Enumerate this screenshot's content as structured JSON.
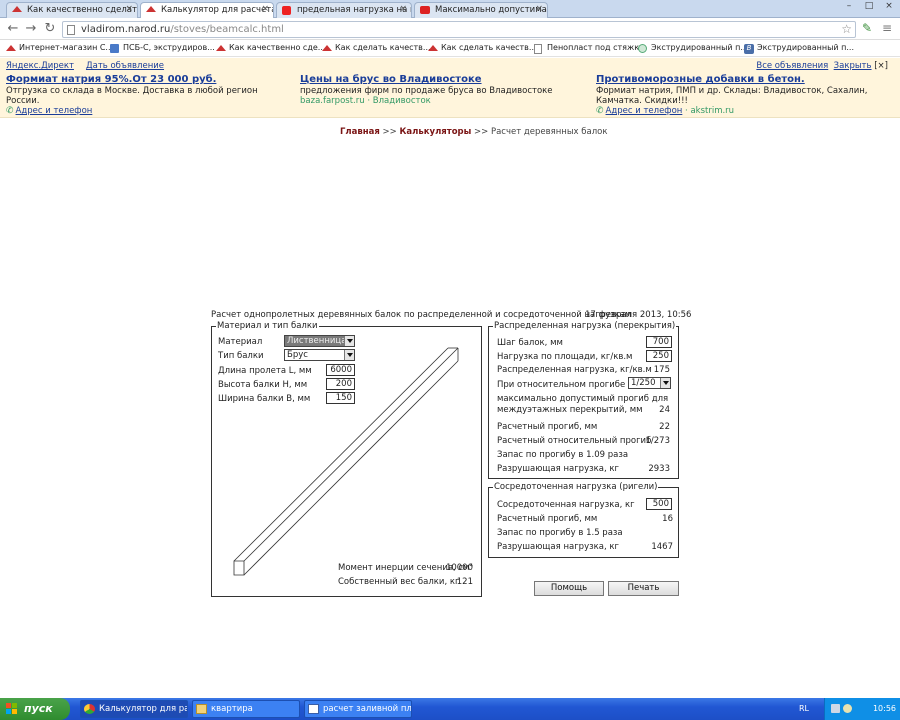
{
  "browser": {
    "tabs": [
      {
        "label": "Как качественно сделать"
      },
      {
        "label": "Калькулятор для расчета д"
      },
      {
        "label": "предельная нагрузка на п"
      },
      {
        "label": "Максимально допустимая"
      }
    ],
    "url_host": "vladirom.narod.ru",
    "url_path": "/stoves/beamcalc.html",
    "bookmarks": [
      {
        "label": "Интернет-магазин С..."
      },
      {
        "label": "ПСБ-С, экструдиров..."
      },
      {
        "label": "Как качественно сде..."
      },
      {
        "label": "Как сделать качеств..."
      },
      {
        "label": "Как сделать качеств..."
      },
      {
        "label": "Пенопласт под стяжку"
      },
      {
        "label": "Экструдированный п..."
      },
      {
        "label": "Экструдированный п..."
      }
    ]
  },
  "direct": {
    "brand": "Яндекс.Директ",
    "give_ad": "Дать объявление",
    "all_ads": "Все объявления",
    "close": "Закрыть",
    "close_box": "[×]",
    "ads": [
      {
        "title": "Формиат натрия 95%.От 23 000 руб.",
        "desc": "Отгрузка со склада в Москве. Доставка в любой регион России.",
        "contact": "Адрес и телефон",
        "site": "",
        "region": ""
      },
      {
        "title": "Цены на брус во Владивостоке",
        "desc": "предложения фирм по продаже бруса во Владивостоке",
        "contact": "",
        "site": "baza.farpost.ru",
        "region": "Владивосток"
      },
      {
        "title": "Противоморозные добавки в бетон.",
        "desc": "Формиат натрия, ПМП и др. Склады: Владивосток, Сахалин, Камчатка. Скидки!!!",
        "contact": "Адрес и телефон",
        "site": "akstrim.ru",
        "region": ""
      }
    ]
  },
  "breadcrumb": {
    "home": "Главная",
    "sep1": " >> ",
    "calcs": "Калькуляторы",
    "sep2": " >> ",
    "current": "Расчет деревянных балок"
  },
  "calc": {
    "heading": "Расчет однопролетных деревянных балок по распределенной и сосредоточенной нагрузкам",
    "date": "17 февраля 2013, 10:56",
    "material_box": {
      "legend": "Материал и тип балки",
      "material_label": "Материал",
      "material_value": "Лиственница",
      "beam_type_label": "Тип балки",
      "beam_type_value": "Брус",
      "span_label": "Длина пролета L, мм",
      "span_value": "6000",
      "height_label": "Высота балки H, мм",
      "height_value": "200",
      "width_label": "Ширина балки B, мм",
      "width_value": "150",
      "inertia_label": "Момент инерции сечения, см⁴",
      "inertia_value": "10000",
      "weight_label": "Собственный вес балки, кг",
      "weight_value": "121"
    },
    "distributed_box": {
      "legend": "Распределенная нагрузка (перекрытия)",
      "step_label": "Шаг балок, мм",
      "step_value": "700",
      "area_load_label": "Нагрузка по площади, кг/кв.м",
      "area_load_value": "250",
      "dist_load_label": "Распределенная нагрузка, кг/кв.м",
      "dist_load_value": "175",
      "rel_label": "При относительном прогибе",
      "rel_value": "1/250",
      "max_label_1": "максимально допустимый прогиб для",
      "max_label_2": "междуэтажных перекрытий, мм",
      "max_value": "24",
      "calc_defl_label": "Расчетный прогиб, мм",
      "calc_defl_value": "22",
      "calc_rel_label": "Расчетный относительный прогиб",
      "calc_rel_value": "1/273",
      "margin_label": "Запас по прогибу в 1.09 раза",
      "break_label": "Разрушающая нагрузка, кг",
      "break_value": "2933"
    },
    "concentrated_box": {
      "legend": "Сосредоточенная нагрузка (ригели)",
      "load_label": "Сосредоточенная нагрузка, кг",
      "load_value": "500",
      "defl_label": "Расчетный прогиб, мм",
      "defl_value": "16",
      "margin_label": "Запас по прогибу в 1.5 раза",
      "break_label": "Разрушающая нагрузка, кг",
      "break_value": "1467"
    },
    "help_button": "Помощь",
    "print_button": "Печать"
  },
  "taskbar": {
    "start": "пуск",
    "tasks": [
      {
        "label": "Калькулятор для ра..."
      },
      {
        "label": "квартира"
      },
      {
        "label": "расчет заливной пл..."
      }
    ],
    "lang": "RL",
    "clock": "10:56"
  },
  "colors": {
    "link_blue": "#1a3d99",
    "breadcrumb_red": "#7a1414",
    "ad_bg": "#fff5dc",
    "taskbar_blue": "#2157d3",
    "start_green": "#2f8c2f"
  }
}
